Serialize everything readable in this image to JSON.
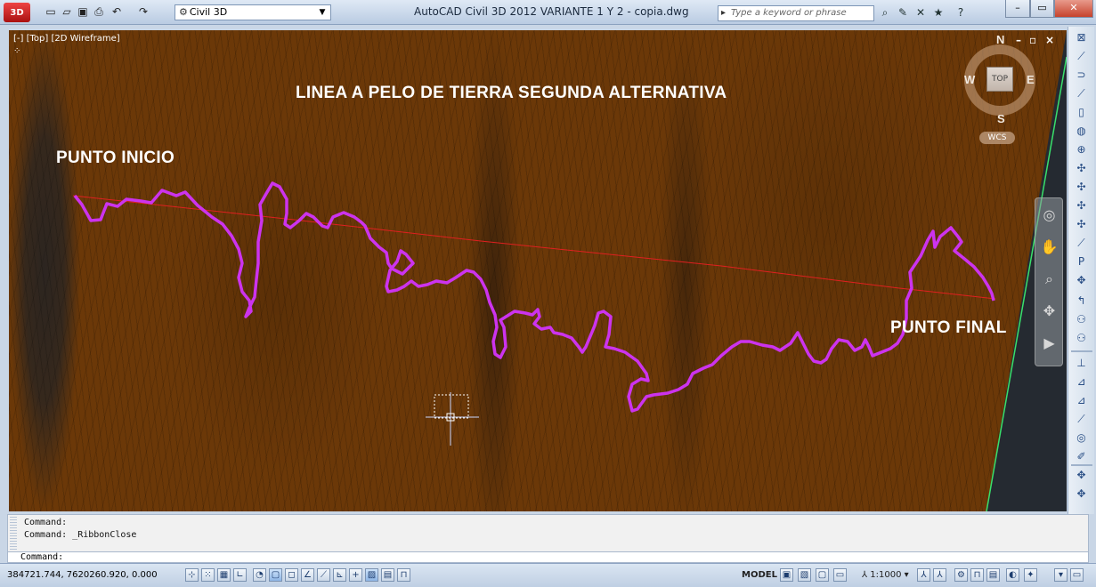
{
  "app": {
    "logo_text": "3D",
    "workspace": "Civil 3D",
    "window_title": "AutoCAD Civil 3D 2012    VARIANTE 1 Y 2 - copia.dwg",
    "search_placeholder": "Type a keyword or phrase"
  },
  "viewport": {
    "label": "[-] [Top] [2D Wireframe]",
    "title_text": "LINEA A PELO DE TIERRA SEGUNDA ALTERNATIVA",
    "start_text": "PUNTO INICIO",
    "end_text": "PUNTO FINAL",
    "route_color": "#cc33ee",
    "reference_line_color": "#e02020",
    "terrain_color": "#6b3808"
  },
  "viewcube": {
    "face": "TOP",
    "north": "N",
    "south": "S",
    "east": "E",
    "west": "W",
    "ucs": "WCS"
  },
  "command": {
    "history": [
      "Command:",
      "Command:  _RibbonClose"
    ],
    "prompt": "Command:"
  },
  "statusbar": {
    "coordinates": "384721.744, 7620260.920, 0.000",
    "model": "MODEL",
    "scale": "1:1000"
  }
}
